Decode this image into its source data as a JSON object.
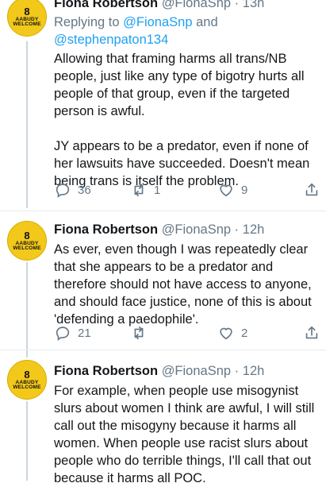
{
  "tweets": [
    {
      "name": "Fiona Robertson",
      "handle": "@FionaSnp",
      "dot": "·",
      "time": "13h",
      "replying_prefix": "Replying to ",
      "replying_user1": "@FionaSnp",
      "replying_and": " and",
      "replying_user2": "@stephenpaton134",
      "para1": "Allowing that framing harms all trans/NB people, just like any type of bigotry hurts all people of that group, even if the targeted person is awful.",
      "para2": "JY appears to be a predator, even if none of her lawsuits have succeeded. Doesn't mean being trans is itself the problem.",
      "replies": "36",
      "retweets": "1",
      "likes": "9"
    },
    {
      "name": "Fiona Robertson",
      "handle": "@FionaSnp",
      "dot": "·",
      "time": "12h",
      "para1": "As ever, even though I was repeatedly clear that she appears to be a predator and therefore should not have access to anyone, and should face justice, none of this is about 'defending a paedophile'.",
      "replies": "21",
      "retweets": "",
      "likes": "2"
    },
    {
      "name": "Fiona Robertson",
      "handle": "@FionaSnp",
      "dot": "·",
      "time": "12h",
      "para1": "For example, when people use misogynist slurs about women I think are awful, I will still call out the misogyny because it harms all women. When people use racist slurs about people who do terrible things, I'll call that out because it harms all POC."
    }
  ],
  "avatar": {
    "line1": "AABUDY",
    "line2": "WELCOME",
    "mark": "8"
  },
  "colors": {
    "accent": "#1da1f2",
    "muted": "#657786",
    "avatar": "#f2c81b",
    "thread": "#ccd6dd"
  }
}
